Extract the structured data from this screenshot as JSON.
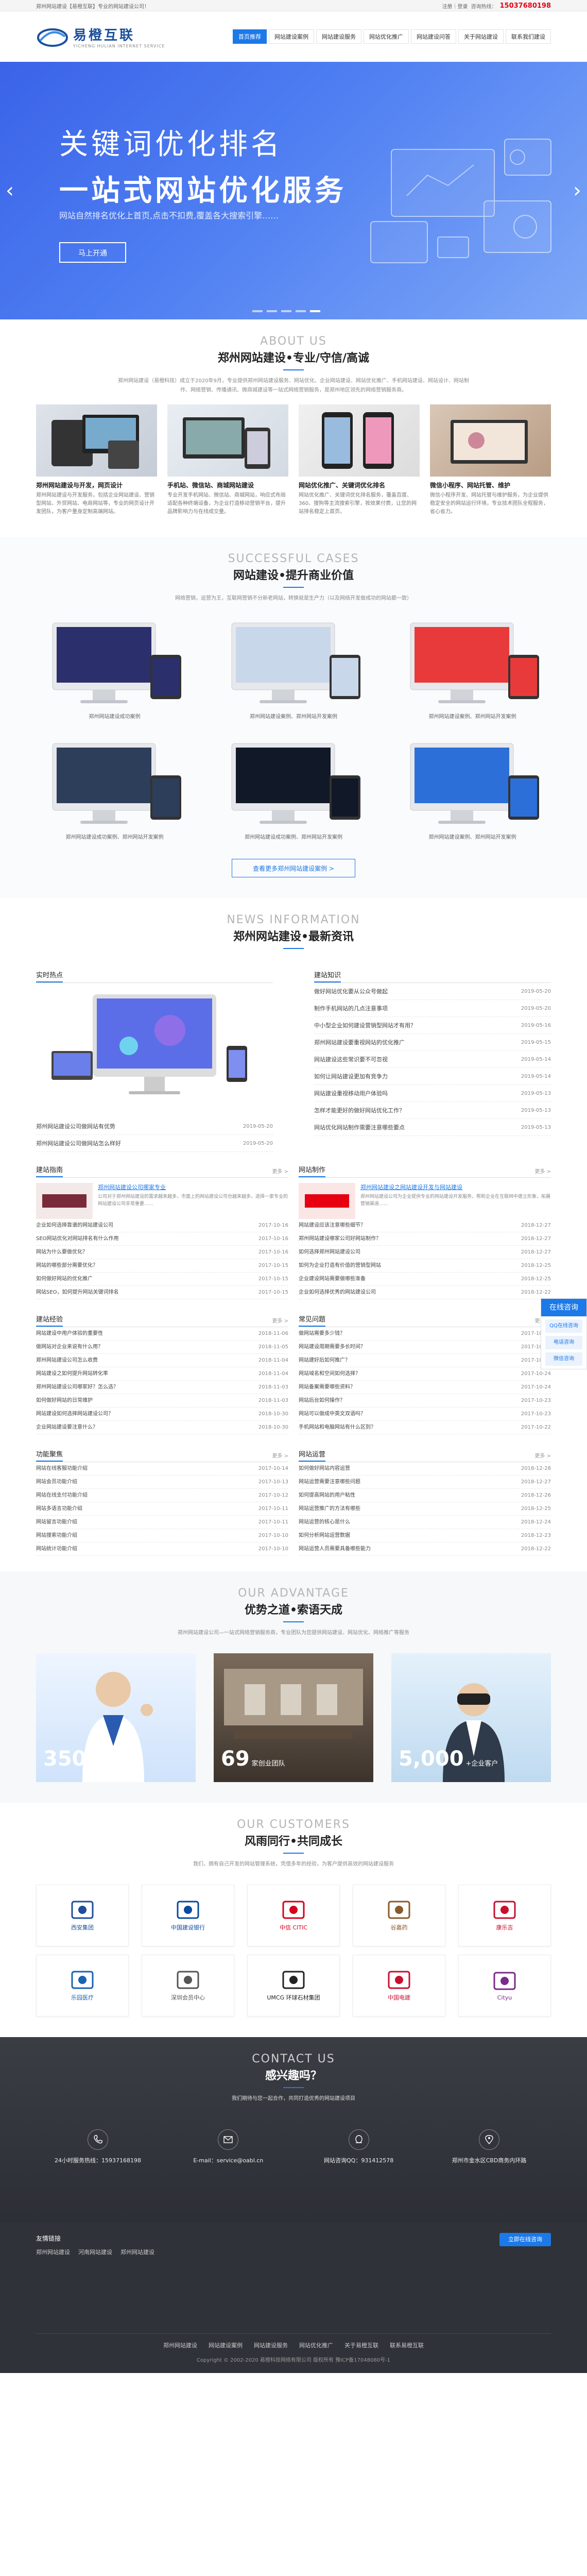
{
  "topbar": {
    "left": "郑州网站建设【易橙互联】专业的网站建设公司！",
    "links": "注册｜登录",
    "phone_prefix": "咨询热线：",
    "phone": "15037680198"
  },
  "logo": {
    "name": "易橙互联",
    "sub": "YICHENG HULIAN INTERNET SERVICE"
  },
  "nav": [
    "首页推荐",
    "网站建设案例",
    "网站建设服务",
    "网站优化推广",
    "网站建设问答",
    "关于网站建设",
    "联系我们建设"
  ],
  "banner": {
    "title1": "关键词优化排名",
    "title2": "一站式网站优化服务",
    "desc": "网站自然排名优化上首页,点击不扣费,覆盖各大搜索引擎……",
    "button": "马上开通"
  },
  "about": {
    "en": "ABOUT US",
    "cn": "郑州网站建设•专业/守信/高诚",
    "desc": "郑州网站建设（易橙科技）成立于2020年9月，专业提供郑州网站建设服务、网站优化、企业网站建设、网站优化推广、手机网站建设、网站设计、网站制作、网络营销、传播通讯、微商城建设等一站式网络营销服务，是郑州地区领先的网络营销服务商。",
    "cards": [
      {
        "title": "郑州网站建设与开发，网页设计",
        "text": "郑州网站建设与开发服务，包括企业网站建设、营销型网站、外贸网站、电商网站等，专业的网页设计开发团队，为客户量身定制高端网站。"
      },
      {
        "title": "手机站、微信站、商城网站建设",
        "text": "专业开发手机网站、微信站、商城网站，响应式布局适配各种终端设备，为企业打造移动营销平台，提升品牌影响力与在线成交量。"
      },
      {
        "title": "网站优化推广、关键词优化排名",
        "text": "网站优化推广、关键词优化排名服务，覆盖百度、360、搜狗等主流搜索引擎，按效果付费，让您的网站排名稳定上首页。"
      },
      {
        "title": "微信小程序、网站托管、维护",
        "text": "微信小程序开发、网站托管与维护服务，为企业提供稳定安全的网站运行环境，专业技术团队全程服务，省心省力。"
      }
    ]
  },
  "cases": {
    "en": "SUCCESSFUL CASES",
    "cn": "网站建设•提升商业价值",
    "desc": "网络营销，运营为王，互联网营销不分新老网站，转换就是生产力（以及网络开发做成功的网站都一致）",
    "items": [
      "郑州网站建设成功案例",
      "郑州网站建设案例、郑州网站开发案例",
      "郑州网站建设案例、郑州网站开发案例",
      "郑州网站建设成功案例、郑州网站开发案例",
      "郑州网站建设成功案例、郑州网站开发案例",
      "郑州网站建设案例、郑州网站开发案例"
    ],
    "more": "查看更多郑州网站建设案例 >"
  },
  "news": {
    "en": "NEWS INFORMATION",
    "cn": "郑州网站建设•最新资讯",
    "hot": {
      "title": "实时热点",
      "list": [
        {
          "t": "郑州网站建设公司做网站有优势",
          "d": "2019-05-20"
        },
        {
          "t": "郑州网站建设公司做网站怎么样好",
          "d": "2019-05-20"
        }
      ]
    },
    "build": {
      "title": "建站知识",
      "list": [
        {
          "t": "做好网站优化要从公众号做起",
          "d": "2019-05-20"
        },
        {
          "t": "制作手机网站的几点注意事项",
          "d": "2019-05-20"
        },
        {
          "t": "中小型企业如何建设营销型网站才有用？",
          "d": "2019-05-16"
        },
        {
          "t": "郑州网站建设要重视网站的优化推广",
          "d": "2019-05-15"
        },
        {
          "t": "网站建设这些常识要不可忽视",
          "d": "2019-05-14"
        },
        {
          "t": "如何让网站建设更加有竞争力",
          "d": "2019-05-14"
        },
        {
          "t": "网站建设重视移动用户体验吗",
          "d": "2019-05-13"
        },
        {
          "t": "怎样才能更好的做好网站优化工作？",
          "d": "2019-05-13"
        },
        {
          "t": "网站优化网站制作需要注意哪些要点",
          "d": "2019-05-13"
        }
      ]
    },
    "grid": [
      {
        "title": "建站指南",
        "more": "更多 >",
        "feat": {
          "t": "郑州网站建设公司哪家专业",
          "d": "公司对于郑州网站建设的需求越来越多，市面上的网站建设公司也越来越多，选择一家专业的网站建设公司非常重要……"
        },
        "list": [
          {
            "t": "企业如何选择靠谱的网站建设公司",
            "d": "2017-10-16"
          },
          {
            "t": "SEO网站优化对网站排名有什么作用",
            "d": "2017-10-16"
          },
          {
            "t": "网站为什么要做优化？",
            "d": "2017-10-16"
          },
          {
            "t": "网站的哪些部分需要优化？",
            "d": "2017-10-15"
          },
          {
            "t": "如何做好网站的优化推广",
            "d": "2017-10-15"
          },
          {
            "t": "网站SEO，如何提升网站关键词排名",
            "d": "2017-10-15"
          }
        ]
      },
      {
        "title": "网站制作",
        "more": "更多 >",
        "feat": {
          "t": "郑州网站建设之网站建设开发与网站建设",
          "d": "郑州网站建设公司为企业提供专业的网站建设开发服务，帮助企业在互联网中建立形象，拓展营销渠道……"
        },
        "list": [
          {
            "t": "网站建设应该注意哪些细节？",
            "d": "2018-12-27"
          },
          {
            "t": "郑州网站建设哪家公司好网站制作？",
            "d": "2018-12-27"
          },
          {
            "t": "如何选择郑州网站建设公司",
            "d": "2018-12-27"
          },
          {
            "t": "如何为企业打造有价值的营销型网站",
            "d": "2018-12-25"
          },
          {
            "t": "企业建设网站需要做哪些准备",
            "d": "2018-12-25"
          },
          {
            "t": "企业如何选择优秀的网站建设公司",
            "d": "2018-12-22"
          }
        ]
      },
      {
        "title": "建站经验",
        "more": "更多 >",
        "list": [
          {
            "t": "网站建设中用户体验的重要性",
            "d": "2018-11-06"
          },
          {
            "t": "做网站对企业来说有什么用？",
            "d": "2018-11-05"
          },
          {
            "t": "郑州网站建设公司怎么收费",
            "d": "2018-11-04"
          },
          {
            "t": "网站建设之如何提升网站转化率",
            "d": "2018-11-04"
          },
          {
            "t": "郑州网站建设公司哪家好？怎么选？",
            "d": "2018-11-03"
          },
          {
            "t": "如何做好网站的日常维护",
            "d": "2018-11-03"
          },
          {
            "t": "网站建设如何选择网站建设公司？",
            "d": "2018-10-30"
          },
          {
            "t": "企业网站建设要注意什么？",
            "d": "2018-10-30"
          }
        ]
      },
      {
        "title": "常见问题",
        "more": "更多 >",
        "list": [
          {
            "t": "做网站需要多少钱？",
            "d": "2017-10-26"
          },
          {
            "t": "网站建设周期需要多长时间？",
            "d": "2017-10-25"
          },
          {
            "t": "网站建好后如何推广？",
            "d": "2017-10-25"
          },
          {
            "t": "网站域名和空间如何选择？",
            "d": "2017-10-24"
          },
          {
            "t": "网站备案需要哪些资料？",
            "d": "2017-10-24"
          },
          {
            "t": "网站后台如何操作？",
            "d": "2017-10-23"
          },
          {
            "t": "网站可以做成中英文双语吗？",
            "d": "2017-10-23"
          },
          {
            "t": "手机网站和电脑网站有什么区别？",
            "d": "2017-10-22"
          }
        ]
      },
      {
        "title": "功能聚焦",
        "more": "更多 >",
        "list": [
          {
            "t": "网站在线客服功能介绍",
            "d": "2017-10-14"
          },
          {
            "t": "网站会员功能介绍",
            "d": "2017-10-13"
          },
          {
            "t": "网站在线支付功能介绍",
            "d": "2017-10-12"
          },
          {
            "t": "网站多语言功能介绍",
            "d": "2017-10-11"
          },
          {
            "t": "网站留言功能介绍",
            "d": "2017-10-11"
          },
          {
            "t": "网站搜索功能介绍",
            "d": "2017-10-10"
          },
          {
            "t": "网站统计功能介绍",
            "d": "2017-10-10"
          }
        ]
      },
      {
        "title": "网站运营",
        "more": "更多 >",
        "list": [
          {
            "t": "如何做好网站内容运营",
            "d": "2018-12-28"
          },
          {
            "t": "网站运营需要注意哪些问题",
            "d": "2018-12-27"
          },
          {
            "t": "如何提高网站的用户粘性",
            "d": "2018-12-26"
          },
          {
            "t": "网站运营推广的方法有哪些",
            "d": "2018-12-25"
          },
          {
            "t": "网站运营的核心是什么",
            "d": "2018-12-24"
          },
          {
            "t": "如何分析网站运营数据",
            "d": "2018-12-23"
          },
          {
            "t": "网站运营人员需要具备哪些能力",
            "d": "2018-12-22"
          }
        ]
      }
    ]
  },
  "advantage": {
    "en": "OUR ADVANTAGE",
    "cn": "优势之道•索语天成",
    "desc": "郑州网站建设公司—一站式网络营销服务商，专业团队为您提供网站建设、网站优化、网络推广等服务",
    "panels": [
      {
        "num": "3500",
        "unit": "+品牌客户"
      },
      {
        "num": "69",
        "unit": "家创业团队"
      },
      {
        "num": "5,000",
        "unit": "+企业客户"
      }
    ]
  },
  "customers": {
    "en": "OUR CUSTOMERS",
    "cn": "风雨同行•共同成长",
    "desc": "我们，拥有自己开发的网站管理系统，凭借多年的经验，为客户提供高效的网站建设服务",
    "logos": [
      {
        "cn": "西安集团",
        "color": "#1e4e9c"
      },
      {
        "cn": "中国建设银行",
        "color": "#0a4aa0"
      },
      {
        "cn": "中信 CITIC",
        "color": "#d6001c"
      },
      {
        "cn": "谷嘉药",
        "color": "#8a5a2a"
      },
      {
        "cn": "康乐吉",
        "color": "#c8102e"
      },
      {
        "cn": "乐园医疗",
        "color": "#1a64b0"
      },
      {
        "cn": "深圳会员中心",
        "color": "#555555"
      },
      {
        "cn": "UMCG 环球石材集团",
        "color": "#222222"
      },
      {
        "cn": "中国电建",
        "color": "#c8102e"
      },
      {
        "cn": "Cityu",
        "color": "#7a2a8a"
      }
    ]
  },
  "contact": {
    "en": "CONTACT US",
    "cn": "感兴趣吗？",
    "desc": "我们期待与您一起合作，共同打造优秀的网站建设项目",
    "items": [
      {
        "icon": "phone-icon",
        "text": "24小时服务热线：15937168198"
      },
      {
        "icon": "mail-icon",
        "text": "E-mail：service@oabl.cn"
      },
      {
        "icon": "qq-icon",
        "text": "网站咨询QQ：931412578"
      },
      {
        "icon": "location-icon",
        "text": "郑州市金水区CBD商务内环路"
      }
    ]
  },
  "footer": {
    "links_title": "友情链接",
    "links": [
      "郑州网站建设",
      "河南网站建设",
      "郑州网站建设"
    ],
    "online": "立即在线咨询",
    "nav": [
      "郑州网站建设",
      "网站建设案例",
      "网站建设服务",
      "网站优化推广",
      "关于易橙互联",
      "联系易橙互联"
    ],
    "copy": "Copyright © 2002-2020 易橙科技网络有限公司 版权所有 豫ICP备17048080号-1"
  },
  "float": {
    "title": "在线咨询",
    "items": [
      "QQ在线咨询",
      "电话咨询",
      "微信咨询"
    ]
  }
}
